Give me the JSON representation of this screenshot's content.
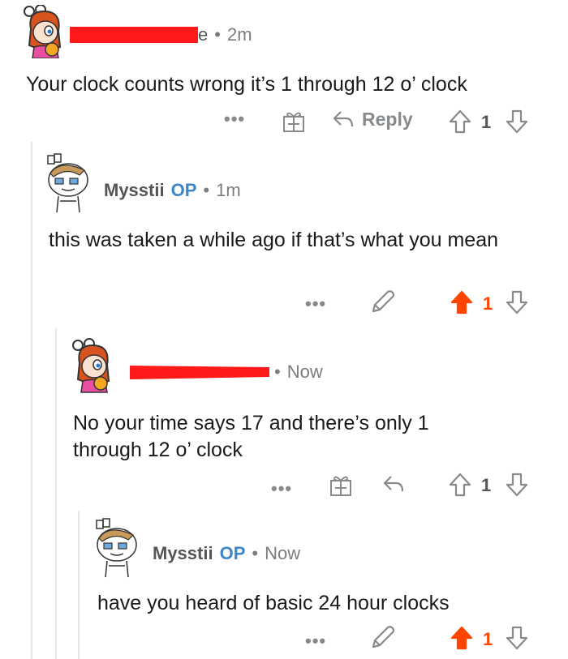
{
  "comments": [
    {
      "author_suffix": "e",
      "time": "2m",
      "body": "Your clock counts wrong it’s 1 through 12 o’ clock",
      "reply_label": "Reply",
      "score": "1",
      "upvoted": false
    },
    {
      "author": "Mysstii",
      "op_badge": "OP",
      "time": "1m",
      "body": "this was taken a while ago if that’s what you mean",
      "score": "1",
      "upvoted": true
    },
    {
      "time": "Now",
      "body": "No your time says 17 and there’s only 1 through 12 o’ clock",
      "score": "1",
      "upvoted": false
    },
    {
      "author": "Mysstii",
      "op_badge": "OP",
      "time": "Now",
      "body": "have you heard of basic 24 hour clocks",
      "score": "1",
      "upvoted": true
    }
  ],
  "common": {
    "separator": "•",
    "more_label": "•••"
  },
  "colors": {
    "upvote_active": "#ff4500",
    "op_badge": "#3f86c8",
    "redaction": "#ff1a1a",
    "thread_line": "#e6e6e6"
  },
  "icons": [
    "more-icon",
    "award-icon",
    "reply-icon",
    "edit-icon",
    "upvote-icon",
    "downvote-icon",
    "avatar-girl-icon",
    "avatar-snoo-icon"
  ]
}
